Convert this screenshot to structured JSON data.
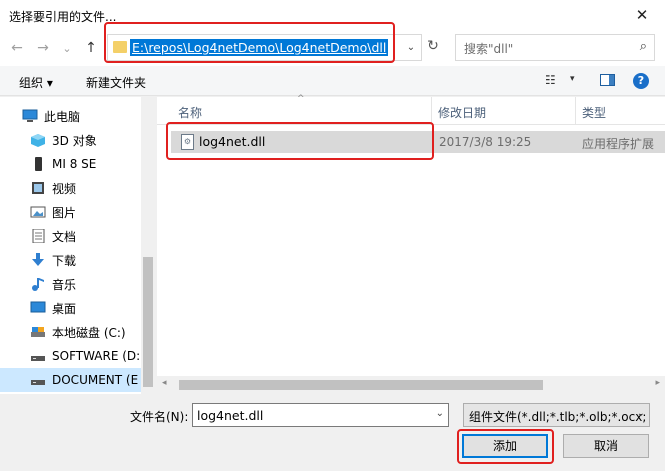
{
  "window": {
    "title": "选择要引用的文件...",
    "close_glyph": "✕"
  },
  "nav": {
    "back": "←",
    "forward": "→",
    "recent": "⌄",
    "up": "↑",
    "address": "E:\\repos\\Log4netDemo\\Log4netDemo\\dll",
    "address_dropdown": "⌄",
    "refresh": "↻",
    "search_placeholder": "搜索\"dll\"",
    "search_icon": "⌕"
  },
  "toolbar": {
    "organize": "组织 ▾",
    "new_folder": "新建文件夹",
    "view_icons": "☷",
    "view_dd": "▾",
    "help": "?"
  },
  "sidebar": {
    "items": [
      {
        "label": "此电脑",
        "icon": "pc-icon"
      },
      {
        "label": "3D 对象",
        "icon": "cube-icon"
      },
      {
        "label": "MI 8 SE",
        "icon": "phone-icon"
      },
      {
        "label": "视频",
        "icon": "video-icon"
      },
      {
        "label": "图片",
        "icon": "picture-icon"
      },
      {
        "label": "文档",
        "icon": "document-icon"
      },
      {
        "label": "下载",
        "icon": "download-icon"
      },
      {
        "label": "音乐",
        "icon": "music-icon"
      },
      {
        "label": "桌面",
        "icon": "desktop-icon"
      },
      {
        "label": "本地磁盘 (C:)",
        "icon": "drive-icon"
      },
      {
        "label": "SOFTWARE (D:",
        "icon": "drive-icon"
      },
      {
        "label": "DOCUMENT (E",
        "icon": "drive-icon"
      }
    ]
  },
  "filelist": {
    "columns": {
      "name": "名称",
      "date": "修改日期",
      "type": "类型",
      "sort_arrow": "^"
    },
    "rows": [
      {
        "name": "log4net.dll",
        "date": "2017/3/8 19:25",
        "type": "应用程序扩展"
      }
    ],
    "scroll_left": "◂",
    "scroll_right": "▸"
  },
  "footer": {
    "filename_label": "文件名(N):",
    "filename_value": "log4net.dll",
    "filename_dd": "⌄",
    "filter_value": "组件文件(*.dll;*.tlb;*.olb;*.ocx;",
    "filter_dd": "⌄",
    "add_label": "添加",
    "cancel_label": "取消"
  },
  "colors": {
    "accent": "#0078d7",
    "highlight_box": "#e0201f",
    "selection": "#cce8ff"
  }
}
